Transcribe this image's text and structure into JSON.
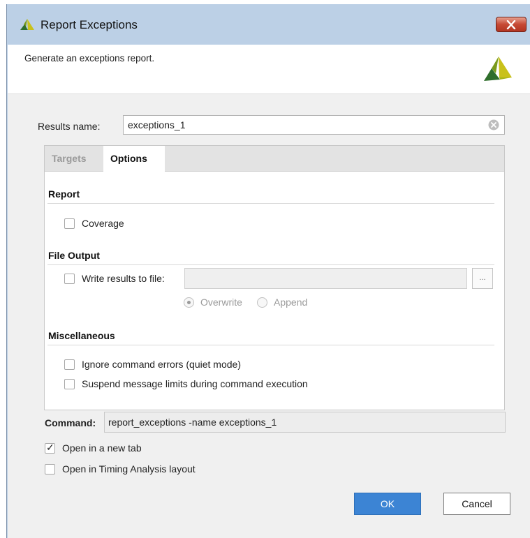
{
  "window": {
    "title": "Report Exceptions",
    "description": "Generate an exceptions report.",
    "close_icon": "close-icon",
    "brand_colors": {
      "logo_green": "#2f6e2c",
      "logo_yellow": "#c9c11a",
      "close_red": "#c64934",
      "accent_blue": "#3c84d4"
    }
  },
  "results": {
    "label": "Results name:",
    "value": "exceptions_1",
    "clear_icon": "clear-circle-icon"
  },
  "tabs": [
    {
      "label": "Targets",
      "active": false
    },
    {
      "label": "Options",
      "active": true
    }
  ],
  "sections": {
    "report": {
      "title": "Report",
      "coverage": {
        "label": "Coverage",
        "checked": false
      }
    },
    "file_output": {
      "title": "File Output",
      "write_results": {
        "label": "Write results to file:",
        "checked": false,
        "path_value": ""
      },
      "browse_label": "...",
      "overwrite": {
        "label": "Overwrite",
        "selected": true
      },
      "append": {
        "label": "Append",
        "selected": false
      }
    },
    "misc": {
      "title": "Miscellaneous",
      "ignore_errors": {
        "label": "Ignore command errors (quiet mode)",
        "checked": false
      },
      "suspend_limits": {
        "label": "Suspend message limits during command execution",
        "checked": false
      }
    }
  },
  "command": {
    "label": "Command:",
    "value": "report_exceptions -name exceptions_1"
  },
  "options": {
    "open_new_tab": {
      "label": "Open in a new tab",
      "checked": true
    },
    "open_timing_layout": {
      "label": "Open in Timing Analysis layout",
      "checked": false
    }
  },
  "buttons": {
    "ok": "OK",
    "cancel": "Cancel"
  }
}
